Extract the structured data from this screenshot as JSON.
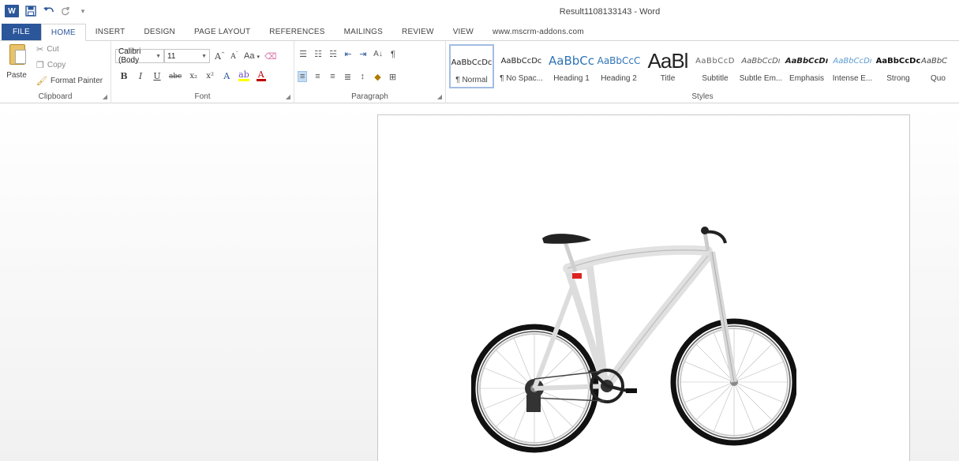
{
  "window": {
    "title": "Result1108133143 - Word"
  },
  "quick_access": {
    "logo": "W",
    "save_icon": "save-icon",
    "undo_icon": "undo-icon",
    "redo_icon": "redo-icon",
    "customize_icon": "customize-icon"
  },
  "tabs": [
    {
      "label": "FILE"
    },
    {
      "label": "HOME"
    },
    {
      "label": "INSERT"
    },
    {
      "label": "DESIGN"
    },
    {
      "label": "PAGE LAYOUT"
    },
    {
      "label": "REFERENCES"
    },
    {
      "label": "MAILINGS"
    },
    {
      "label": "REVIEW"
    },
    {
      "label": "VIEW"
    },
    {
      "label": "www.mscrm-addons.com"
    }
  ],
  "clipboard": {
    "group_label": "Clipboard",
    "paste_label": "Paste",
    "cut_label": "Cut",
    "copy_label": "Copy",
    "format_painter_label": "Format Painter"
  },
  "font": {
    "group_label": "Font",
    "font_name": "Calibri (Body",
    "font_size": "11",
    "grow": "A",
    "shrink": "A",
    "change_case": "Aa",
    "bold": "B",
    "italic": "I",
    "underline": "U",
    "strikethrough": "abc",
    "subscript": "x₂",
    "superscript": "x²",
    "text_effects": "A",
    "highlight": "ab",
    "font_color": "A"
  },
  "paragraph": {
    "group_label": "Paragraph",
    "sort": "A↓",
    "show_marks": "¶"
  },
  "styles": {
    "group_label": "Styles",
    "items": [
      {
        "sample": "AaBbCcDc",
        "name": "¶ Normal"
      },
      {
        "sample": "AaBbCcDc",
        "name": "¶ No Spac..."
      },
      {
        "sample": "AaBbCc",
        "name": "Heading 1"
      },
      {
        "sample": "AaBbCcC",
        "name": "Heading 2"
      },
      {
        "sample": "AaBl",
        "name": "Title"
      },
      {
        "sample": "AaBbCcD",
        "name": "Subtitle"
      },
      {
        "sample": "AaBbCcDı",
        "name": "Subtle Em..."
      },
      {
        "sample": "AaBbCcDı",
        "name": "Emphasis"
      },
      {
        "sample": "AaBbCcDı",
        "name": "Intense E..."
      },
      {
        "sample": "AaBbCcDc",
        "name": "Strong"
      },
      {
        "sample": "AaBbC",
        "name": "Quo"
      }
    ]
  },
  "colors": {
    "accent": "#2b579a",
    "heading_blue": "#2e74b5"
  },
  "document": {
    "image": "bicycle-image"
  }
}
